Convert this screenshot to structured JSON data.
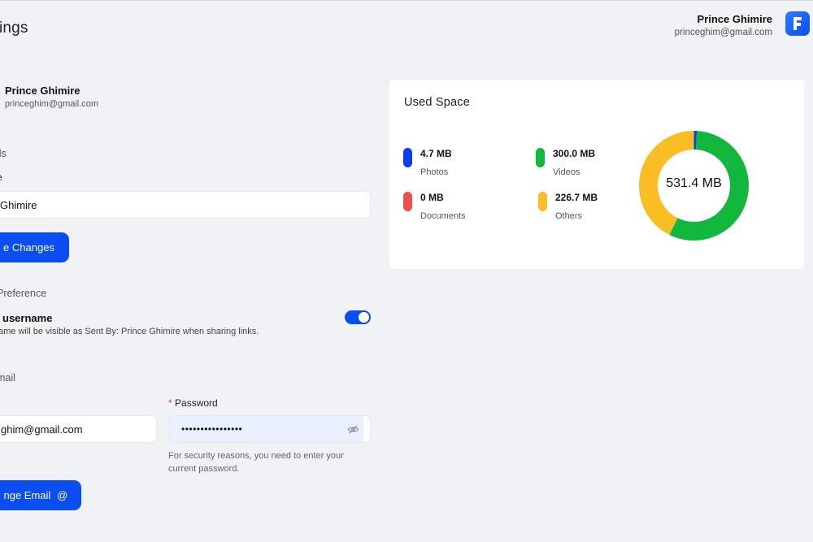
{
  "header": {
    "page_title": "ttings",
    "user_name": "Prince Ghimire",
    "user_email": "princeghim@gmail.com",
    "logo_icon": "app-logo-icon"
  },
  "profile": {
    "name": "Prince Ghimire",
    "email": "princeghim@gmail.com"
  },
  "details": {
    "section_label": "ils",
    "name_label": "e",
    "name_value": "Ghimire",
    "save_button": "e Changes"
  },
  "preference": {
    "section_label": "Preference",
    "title": "username",
    "description": "ame will be visible as Sent By: Prince Ghimire when sharing links.",
    "toggle_on": true
  },
  "email_section": {
    "section_label": "mail",
    "email_value": "ghim@gmail.com",
    "password_required_mark": "*",
    "password_label": "Password",
    "password_value": "••••••••••••••••",
    "password_help": "For security reasons, you need to enter your current password.",
    "change_button": "nge Email",
    "change_button_icon": "@"
  },
  "used_space": {
    "title": "Used Space",
    "total": "531.4 MB",
    "items": [
      {
        "label": "Photos",
        "value": "4.7 MB",
        "color": "#0a3ff0"
      },
      {
        "label": "Videos",
        "value": "300.0 MB",
        "color": "#12b83e"
      },
      {
        "label": "Documents",
        "value": "0 MB",
        "color": "#ef4e4e"
      },
      {
        "label": "Others",
        "value": "226.7 MB",
        "color": "#fbbd24"
      }
    ]
  },
  "colors": {
    "accent": "#0a4df0",
    "background": "#f1f2f5",
    "card": "#ffffff"
  }
}
